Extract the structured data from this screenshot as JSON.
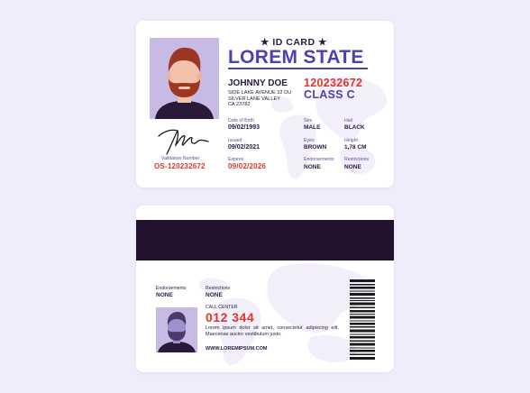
{
  "front": {
    "title": "★ ID CARD ★",
    "state": "LOREM STATE",
    "name": "JOHNNY DOE",
    "address_lines": [
      "SIDE LAKE AVENUE 32 DU",
      "SILVER LANE VALLEY",
      "CA 23782"
    ],
    "document_number": "120232672",
    "class": "CLASS C",
    "validation_label": "Validation Number",
    "validation_number": "OS-120232672",
    "fields": {
      "dob_label": "Date of Birth",
      "dob": "09/02/1993",
      "issued_label": "Issued",
      "issued": "09/02/2021",
      "expires_label": "Expires",
      "expires": "09/02/2026",
      "sex_label": "Sex",
      "sex": "MALE",
      "hair_label": "Hair",
      "hair": "BLACK",
      "eyes_label": "Eyes",
      "eyes": "BROWN",
      "height_label": "Height",
      "height": "1,78 CM",
      "endorsements_label": "Endorsements",
      "endorsements": "NONE",
      "restrictions_label": "Restrictions",
      "restrictions": "NONE"
    }
  },
  "back": {
    "endorsements_label": "Endorsements",
    "endorsements": "NONE",
    "restrictions_label": "Restrictions",
    "restrictions": "NONE",
    "call_center_label": "CALL CENTER",
    "call_center_number": "012 344",
    "lorem": "Lorem ipsum dolor sit amet, consectetur adipiscing elit. Maecenas auctor vestibulum justo.",
    "website": "WWW.LOREMIPSUM.COM"
  },
  "colors": {
    "background": "#efedfb",
    "accent_blue": "#4b40b8",
    "accent_red": "#e5322d",
    "dark": "#23122e",
    "photo_bg": "#c7bbe6"
  }
}
